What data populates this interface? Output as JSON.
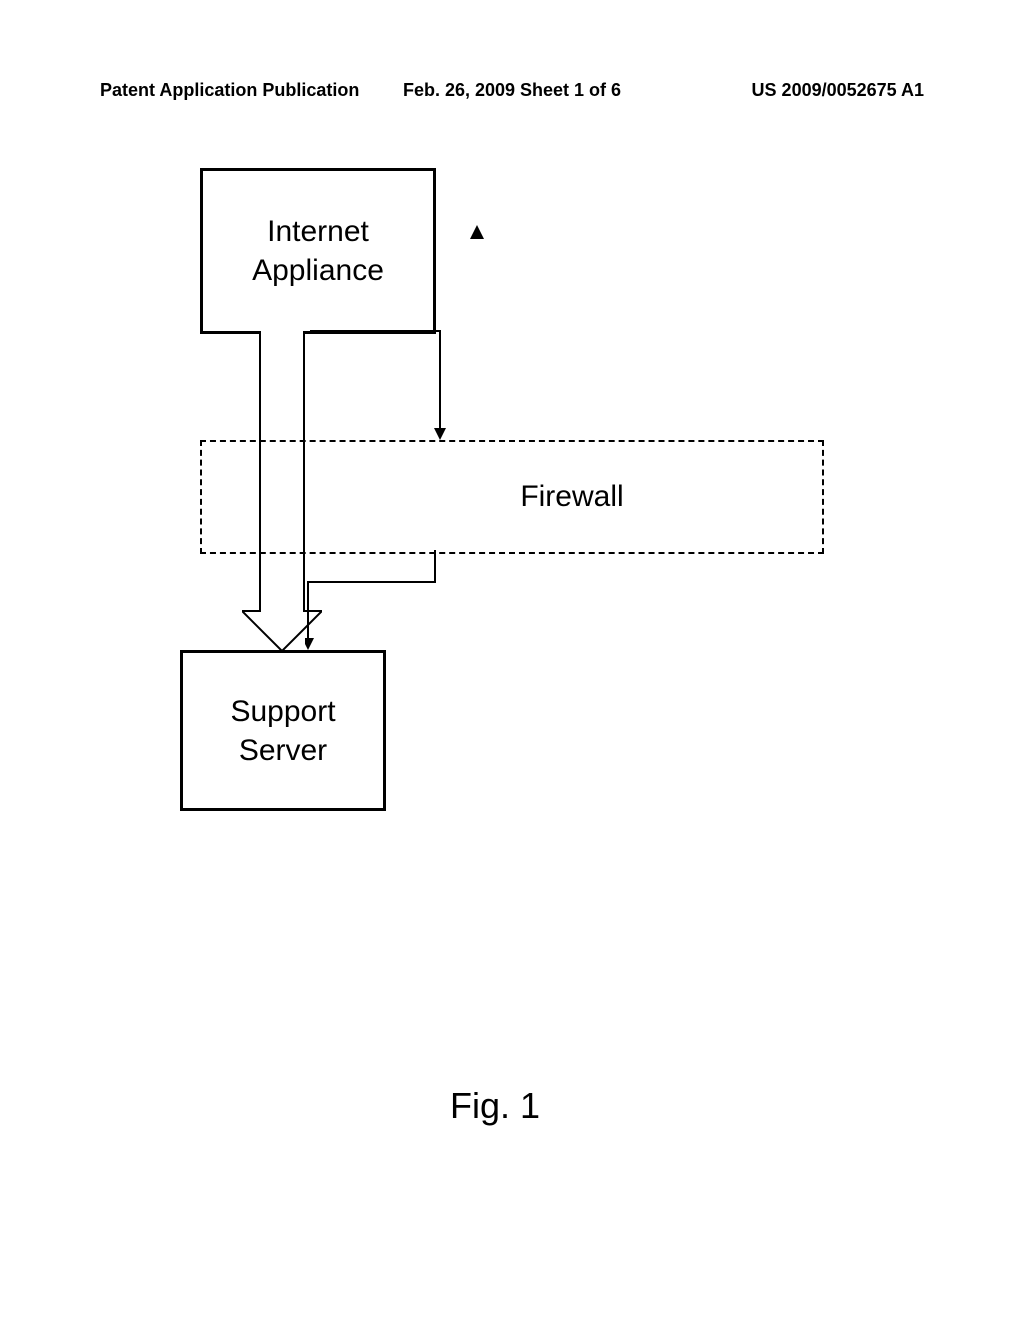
{
  "header": {
    "left": "Patent Application Publication",
    "center": "Feb. 26, 2009  Sheet 1 of 6",
    "right": "US 2009/0052675 A1"
  },
  "diagram": {
    "internet_appliance_line1": "Internet",
    "internet_appliance_line2": "Appliance",
    "firewall": "Firewall",
    "server_line1": "Support",
    "server_line2": "Server"
  },
  "figure_label": "Fig.  1"
}
